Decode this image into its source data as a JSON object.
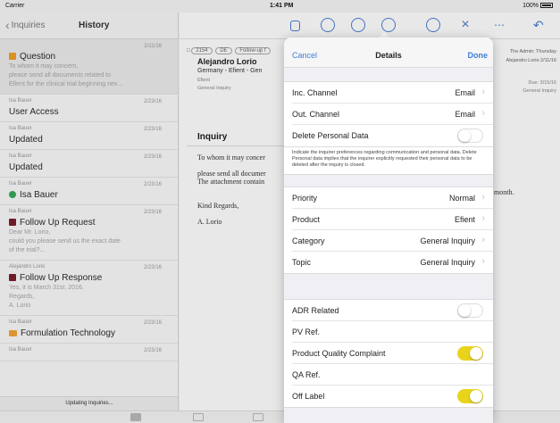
{
  "status_bar": {
    "carrier": "Carrier",
    "time": "1:41 PM",
    "battery": "100%"
  },
  "left_pane": {
    "back_label": "Inquiries",
    "title": "History",
    "updating": "Updating Inquiries...",
    "items": [
      {
        "meta": "",
        "date": "2/11/16",
        "icon": "flag-orange",
        "subject": "Question",
        "preview": "To whom it may concern,\nplease send all documents related to\nEfient for the clinical trial beginning nex..."
      },
      {
        "meta": "Isa Bauer",
        "date": "2/23/16",
        "icon": "",
        "subject": "User Access",
        "preview": ""
      },
      {
        "meta": "Isa Bauer",
        "date": "2/23/16",
        "icon": "",
        "subject": "Updated",
        "preview": ""
      },
      {
        "meta": "Isa Bauer",
        "date": "2/23/16",
        "icon": "",
        "subject": "Updated",
        "preview": ""
      },
      {
        "meta": "Isa Bauer",
        "date": "2/23/16",
        "icon": "dot-green",
        "subject": "Isa Bauer",
        "preview": ""
      },
      {
        "meta": "Isa Bauer",
        "date": "2/23/16",
        "icon": "flag-maroon",
        "subject": "Follow Up Request",
        "preview": "Dear Mr. Lorio,\ncould you please send us the exact date\nof the trial?..."
      },
      {
        "meta": "Alejandro Lorio",
        "date": "2/23/16",
        "icon": "flag-maroon",
        "subject": "Follow Up Response",
        "preview": "Yes, it is March 31st, 2016.\nRegards,\nA. Lorio"
      },
      {
        "meta": "Isa Bauer",
        "date": "2/23/16",
        "icon": "mail-orange",
        "subject": "Formulation Technology",
        "preview": ""
      },
      {
        "meta": "Isa Bauer",
        "date": "2/23/16",
        "icon": "",
        "subject": "",
        "preview": ""
      }
    ]
  },
  "detail": {
    "tags": [
      "2154",
      "DE",
      "Follow-up f"
    ],
    "author": "Alejandro Lorio",
    "company": "Germany - Efient - Gen",
    "product": "Efient",
    "category": "General Inquiry",
    "to_line": "The Admin: Thursday",
    "to_line2": "Alejandro Lorio 2/11/16",
    "due": "Due: 3/15/16",
    "due_cat": "General Inquiry",
    "heading": "Inquiry",
    "body": "To whom it may concer\n\nplease send all documer\nThe attachment contain\n\n\nKind Regards,\n\nA. Lorio",
    "month": "month."
  },
  "popover": {
    "cancel": "Cancel",
    "title": "Details",
    "done": "Done",
    "channel_group": [
      {
        "label": "Inc. Channel",
        "value": "Email"
      },
      {
        "label": "Out. Channel",
        "value": "Email"
      }
    ],
    "delete_label": "Delete Personal Data",
    "delete_note": "Indicate the inquirer preferences regarding communication and personal data. Delete Personal data implies that the inquirer explicitly requested their personal data to be deleted after the inquiry is closed.",
    "class_group": [
      {
        "label": "Priority",
        "value": "Normal"
      },
      {
        "label": "Product",
        "value": "Efient"
      },
      {
        "label": "Category",
        "value": "General Inquiry"
      },
      {
        "label": "Topic",
        "value": "General Inquiry"
      }
    ],
    "flags_group": {
      "adr": "ADR Related",
      "pv": "PV Ref.",
      "pqc": "Product Quality Complaint",
      "qa": "QA Ref.",
      "off_label": "Off Label"
    },
    "toggle_states": {
      "delete_personal_data": false,
      "adr_related": false,
      "pqc": true,
      "off_label": true
    }
  },
  "colors": {
    "accent": "#3d7ddb",
    "toggle_on": "#e9d41c",
    "flag_orange": "#f0a027",
    "flag_maroon": "#7b1f2f"
  }
}
